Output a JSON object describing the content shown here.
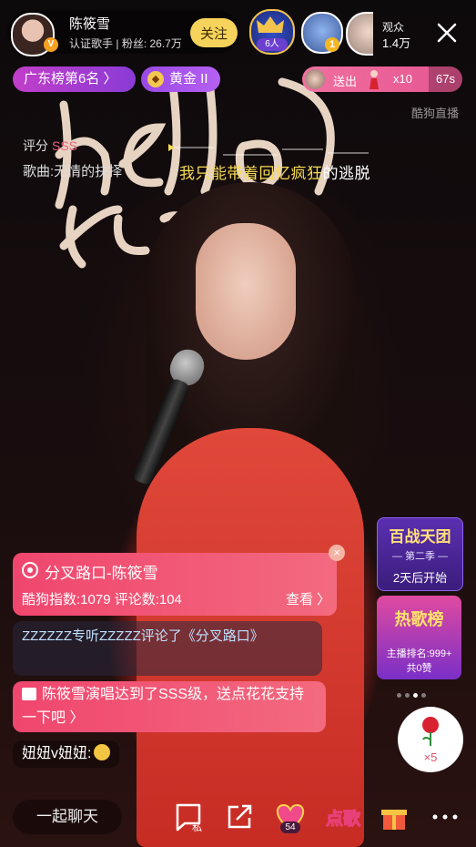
{
  "host": {
    "name": "陈筱雪",
    "role": "认证歌手",
    "fans": "粉丝: 26.7万",
    "follow_label": "关注"
  },
  "guard": {
    "count": "6人"
  },
  "viewer_rank": "1",
  "audience": {
    "label": "观众",
    "count": "1.4万"
  },
  "rank_badge": "广东榜第6名 〉",
  "level_badge": "黄金 II",
  "level_gem": "◆",
  "gift_banner": {
    "label": "送出",
    "multiplier": "x10",
    "timer": "67s"
  },
  "watermark": "酷狗直播",
  "score": {
    "label": "评分",
    "grade": "SSS"
  },
  "song_line": "歌曲:无情的抉择",
  "lyric": {
    "sung": "我只能带着回忆疯狂",
    "unsung": "的逃脱"
  },
  "song_card": {
    "title": "分叉路口-陈筱雪",
    "stats": "酷狗指数:1079  评论数:104",
    "view_label": "查看 〉",
    "close": "×"
  },
  "chat_messages": [
    {
      "text": "ZZZZZZ专听ZZZZZ评论了《分叉路口》"
    }
  ],
  "system_message": "陈筱雪演唱达到了SSS级，送点花花支持一下吧 〉",
  "user_message": {
    "text": "妞妞v妞妞:"
  },
  "side_panels": {
    "event1": {
      "title": "百战天团",
      "season": "— 第二季 —",
      "status": "2天后开始"
    },
    "event2": {
      "title": "热歌榜",
      "rank": "主播排名:999+",
      "likes": "共0赞"
    }
  },
  "flower_count": "×5",
  "bottom": {
    "chat_placeholder": "一起聊天",
    "dm_label": "私",
    "pk_count": "54",
    "song_label": "点歌"
  },
  "colors": {
    "accent_pink": "#f0466e",
    "follow_yellow": "#f6d35a",
    "lyric_sung": "#f6dc54",
    "level_purple": "#9a48e6"
  },
  "icons": [
    "close-icon",
    "disc-icon",
    "gift-icon",
    "share-icon",
    "message-icon",
    "more-icon",
    "rose-icon",
    "fire-icon"
  ]
}
